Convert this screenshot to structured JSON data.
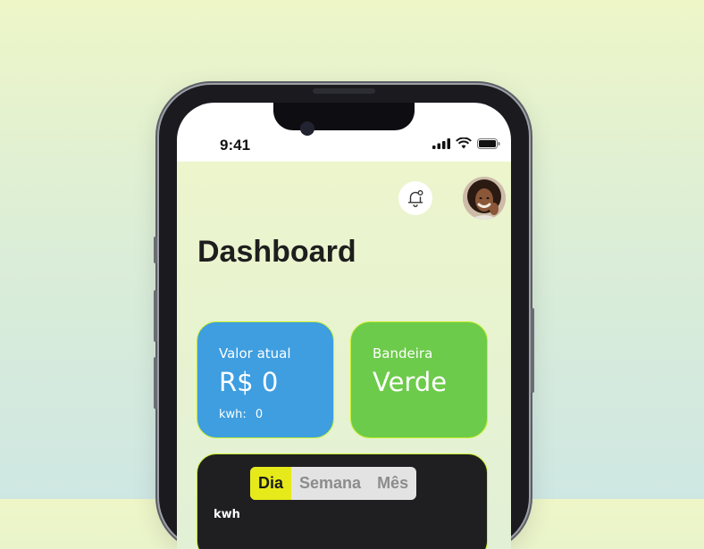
{
  "status_bar": {
    "time": "9:41"
  },
  "header": {
    "title": "Dashboard"
  },
  "cards": {
    "current_value": {
      "label": "Valor atual",
      "value": "R$ 0",
      "sub_label": "kwh:",
      "sub_value": "0"
    },
    "flag": {
      "label": "Bandeira",
      "value": "Verde"
    }
  },
  "consumption": {
    "tabs": [
      "Dia",
      "Semana",
      "Mês"
    ],
    "selected_tab": "Dia",
    "unit": "kwh"
  },
  "colors": {
    "card_blue": "#3e9ee0",
    "card_green": "#6ccb4a",
    "accent_yellow": "#e6ea1a",
    "border_lime": "#c8f02a"
  }
}
